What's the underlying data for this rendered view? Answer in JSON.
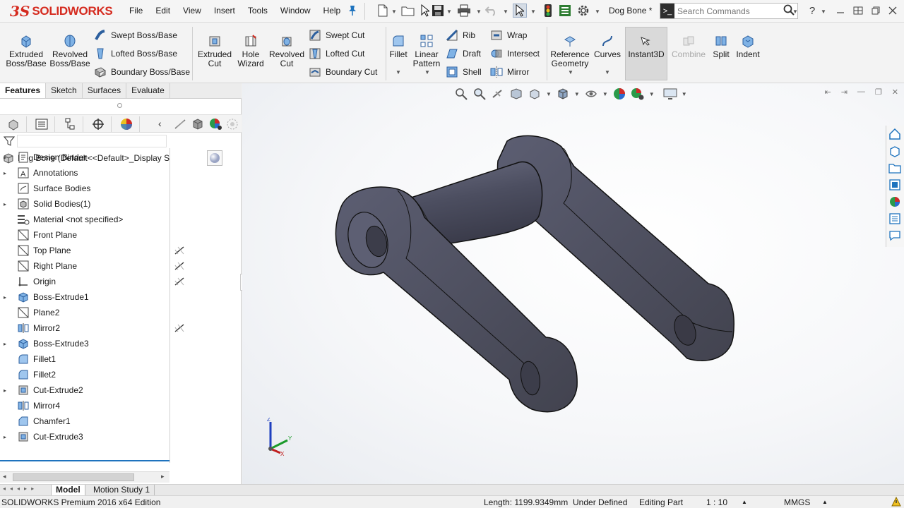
{
  "app": {
    "logo_text": "SOLIDWORKS",
    "document_name": "Dog Bone *"
  },
  "menu": [
    "File",
    "Edit",
    "View",
    "Insert",
    "Tools",
    "Window",
    "Help"
  ],
  "search": {
    "placeholder": "Search Commands"
  },
  "command_manager": {
    "extruded_boss": "Extruded\nBoss/Base",
    "revolved_boss": "Revolved\nBoss/Base",
    "swept_boss": "Swept Boss/Base",
    "lofted_boss": "Lofted Boss/Base",
    "boundary_boss": "Boundary Boss/Base",
    "extruded_cut": "Extruded\nCut",
    "hole_wizard": "Hole\nWizard",
    "revolved_cut": "Revolved\nCut",
    "swept_cut": "Swept Cut",
    "lofted_cut": "Lofted Cut",
    "boundary_cut": "Boundary Cut",
    "fillet": "Fillet",
    "linear_pattern": "Linear\nPattern",
    "rib": "Rib",
    "draft": "Draft",
    "shell": "Shell",
    "wrap": "Wrap",
    "intersect": "Intersect",
    "mirror": "Mirror",
    "reference_geometry": "Reference\nGeometry",
    "curves": "Curves",
    "instant3d": "Instant3D",
    "combine": "Combine",
    "split": "Split",
    "indent": "Indent"
  },
  "cm_tabs": [
    "Features",
    "Sketch",
    "Surfaces",
    "Evaluate"
  ],
  "tree": {
    "root": "Dog Bone  (Default<<Default>_Display S",
    "items": [
      {
        "label": "Design Binder",
        "icon": "design-binder-icon",
        "expandable": true
      },
      {
        "label": "Annotations",
        "icon": "annotations-icon",
        "expandable": true
      },
      {
        "label": "Surface Bodies",
        "icon": "surface-bodies-icon",
        "expandable": false
      },
      {
        "label": "Solid Bodies(1)",
        "icon": "solid-bodies-icon",
        "expandable": true
      },
      {
        "label": "Material <not specified>",
        "icon": "material-icon",
        "expandable": false
      },
      {
        "label": "Front Plane",
        "icon": "plane-icon",
        "expandable": false
      },
      {
        "label": "Top Plane",
        "icon": "plane-icon",
        "expandable": false
      },
      {
        "label": "Right Plane",
        "icon": "plane-icon",
        "expandable": false
      },
      {
        "label": "Origin",
        "icon": "origin-icon",
        "expandable": false
      },
      {
        "label": "Boss-Extrude1",
        "icon": "boss-extrude-icon",
        "expandable": true
      },
      {
        "label": "Plane2",
        "icon": "plane-icon",
        "expandable": false
      },
      {
        "label": "Mirror2",
        "icon": "mirror-feature-icon",
        "expandable": false
      },
      {
        "label": "Boss-Extrude3",
        "icon": "boss-extrude-icon",
        "expandable": true
      },
      {
        "label": "Fillet1",
        "icon": "fillet-feature-icon",
        "expandable": false
      },
      {
        "label": "Fillet2",
        "icon": "fillet-feature-icon",
        "expandable": false
      },
      {
        "label": "Cut-Extrude2",
        "icon": "cut-extrude-icon",
        "expandable": true
      },
      {
        "label": "Mirror4",
        "icon": "mirror-feature-icon",
        "expandable": false
      },
      {
        "label": "Chamfer1",
        "icon": "chamfer-feature-icon",
        "expandable": false
      },
      {
        "label": "Cut-Extrude3",
        "icon": "cut-extrude-icon",
        "expandable": true
      }
    ]
  },
  "bottom_tabs": {
    "model": "Model",
    "motion": "Motion Study 1"
  },
  "status": {
    "edition": "SOLIDWORKS Premium 2016 x64 Edition",
    "length": "Length: 1199.9349mm",
    "defined": "Under Defined",
    "mode": "Editing Part",
    "scale": "1 : 10",
    "units": "MMGS"
  },
  "colors": {
    "brand": "#d52a1e",
    "accent": "#1e73be",
    "part": "#5a5c6e"
  }
}
